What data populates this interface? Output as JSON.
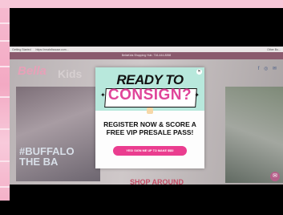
{
  "browser": {
    "bookmarks": [
      "Getting Started",
      "https://rmalsfbazaar.com..."
    ],
    "other_bookmarks": "Other Bo..."
  },
  "site": {
    "announcement": "BellaKids Shopping Hub. 716-444-8358",
    "logo": "Bella",
    "logo_tail": "Kids",
    "hashtag": "#BUFFALO\nTHE BA",
    "partial_heading": "SHOP AROUND",
    "social_icons": "f ◎ ✉"
  },
  "popup": {
    "title_line1": "READY TO",
    "title_line2": "CONSIGN?",
    "message": "REGISTER NOW & SCORE A FREE VIP PRESALE PASS!",
    "cta_label": "YES! SIGN ME UP TO MAKE $$$!",
    "close_symbol": "✕"
  },
  "colors": {
    "modal_header": "#b8e8dc",
    "accent_pink": "#ea3d8f",
    "frame_pink": "#f6b9cf"
  }
}
